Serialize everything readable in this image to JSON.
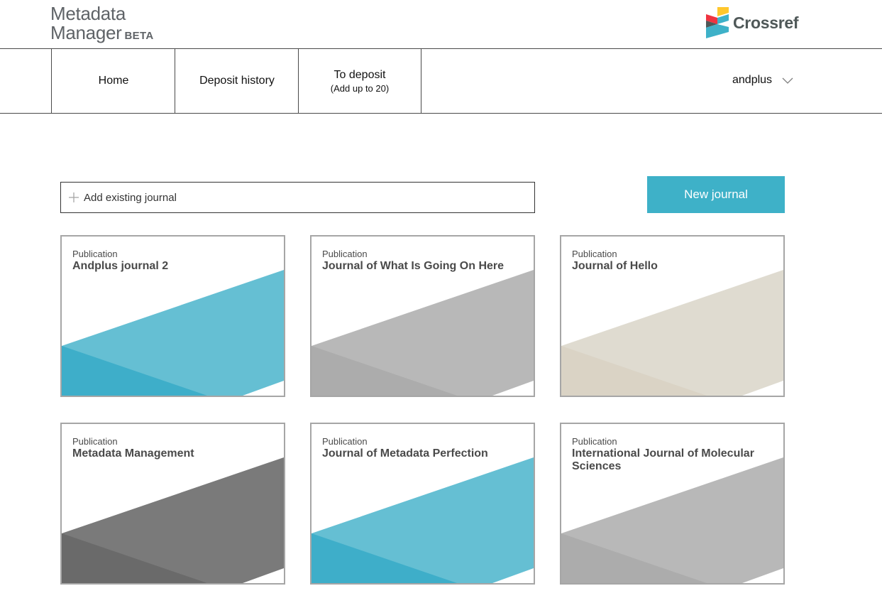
{
  "header": {
    "logo_line1": "Metadata",
    "logo_line2": "Manager",
    "logo_badge": "BETA",
    "brand": "Crossref"
  },
  "nav": {
    "home": "Home",
    "deposit_history": "Deposit history",
    "to_deposit": "To deposit",
    "to_deposit_sub": "(Add up to 20)",
    "user": "andplus"
  },
  "search": {
    "placeholder": "Add existing journal",
    "value": ""
  },
  "new_journal_label": "New journal",
  "cards": [
    {
      "label": "Publication",
      "title": "Andplus journal 2",
      "color_main": "#65bfd3",
      "color_dark": "#3eaec9"
    },
    {
      "label": "Publication",
      "title": "Journal of What Is Going On Here",
      "color_main": "#b8b8b8",
      "color_dark": "#acacac"
    },
    {
      "label": "Publication",
      "title": "Journal of Hello",
      "color_main": "#dfdbd0",
      "color_dark": "#dad3c5"
    },
    {
      "label": "Publication",
      "title": "Metadata Management",
      "color_main": "#7a7a7a",
      "color_dark": "#6a6a6a"
    },
    {
      "label": "Publication",
      "title": "Journal of Metadata Perfection",
      "color_main": "#65bfd3",
      "color_dark": "#3eaec9"
    },
    {
      "label": "Publication",
      "title": "International Journal of Molecular Sciences",
      "color_main": "#b8b8b8",
      "color_dark": "#acacac"
    }
  ]
}
